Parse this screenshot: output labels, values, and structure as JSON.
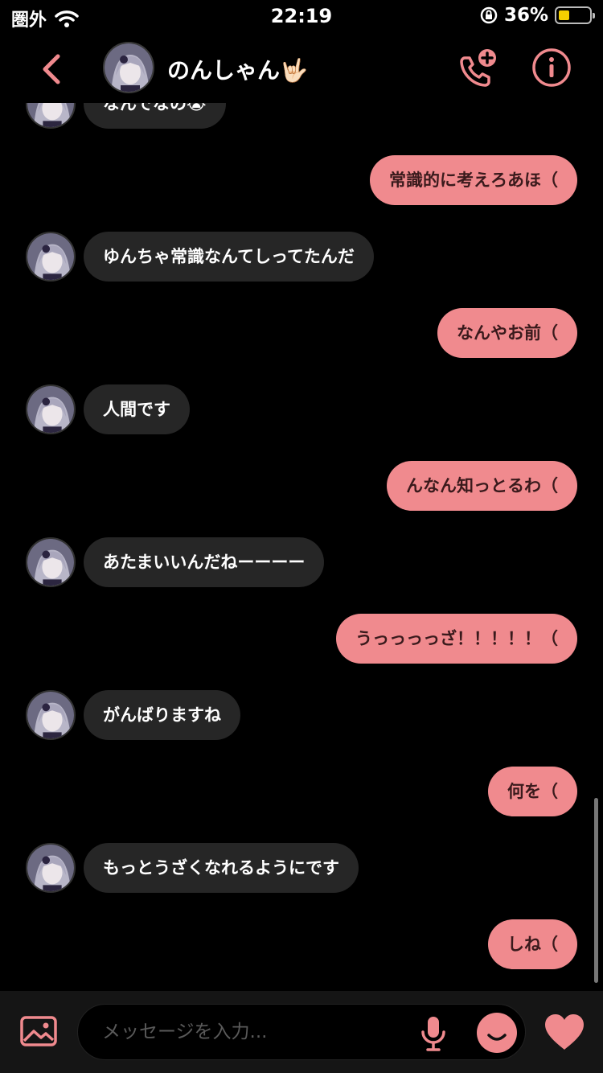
{
  "status_bar": {
    "carrier": "圏外",
    "time": "22:19",
    "battery_percent": "36%",
    "battery_level": 0.36,
    "icons": [
      "wifi-icon",
      "rotation-lock-icon",
      "battery-icon"
    ]
  },
  "header": {
    "contact_name": "のんしゃん🤟🏻",
    "icons": [
      "back-chevron-icon",
      "video-call-add-icon",
      "info-icon"
    ]
  },
  "messages": [
    {
      "dir": "in",
      "text": "なんでなの😭"
    },
    {
      "dir": "out",
      "text": "常識的に考えろあほ（"
    },
    {
      "dir": "in",
      "text": "ゆんちゃ常識なんてしってたんだ"
    },
    {
      "dir": "out",
      "text": "なんやお前（"
    },
    {
      "dir": "in",
      "text": "人間です"
    },
    {
      "dir": "out",
      "text": "んなん知っとるわ（"
    },
    {
      "dir": "in",
      "text": "あたまいいんだねーーーー"
    },
    {
      "dir": "out",
      "text": "うっっっっざ！！！！！（"
    },
    {
      "dir": "in",
      "text": "がんばりますね"
    },
    {
      "dir": "out",
      "text": "何を（"
    },
    {
      "dir": "in",
      "text": "もっとうざくなれるようにです"
    },
    {
      "dir": "out",
      "text": "しね（"
    }
  ],
  "composer": {
    "placeholder": "メッセージを入力...",
    "icons": [
      "gallery-icon",
      "microphone-icon",
      "emoji-icon",
      "heart-icon"
    ]
  },
  "colors": {
    "accent": "#f08a8e",
    "background": "#000000",
    "incoming_bubble": "#262626",
    "battery": "#f5d000"
  }
}
